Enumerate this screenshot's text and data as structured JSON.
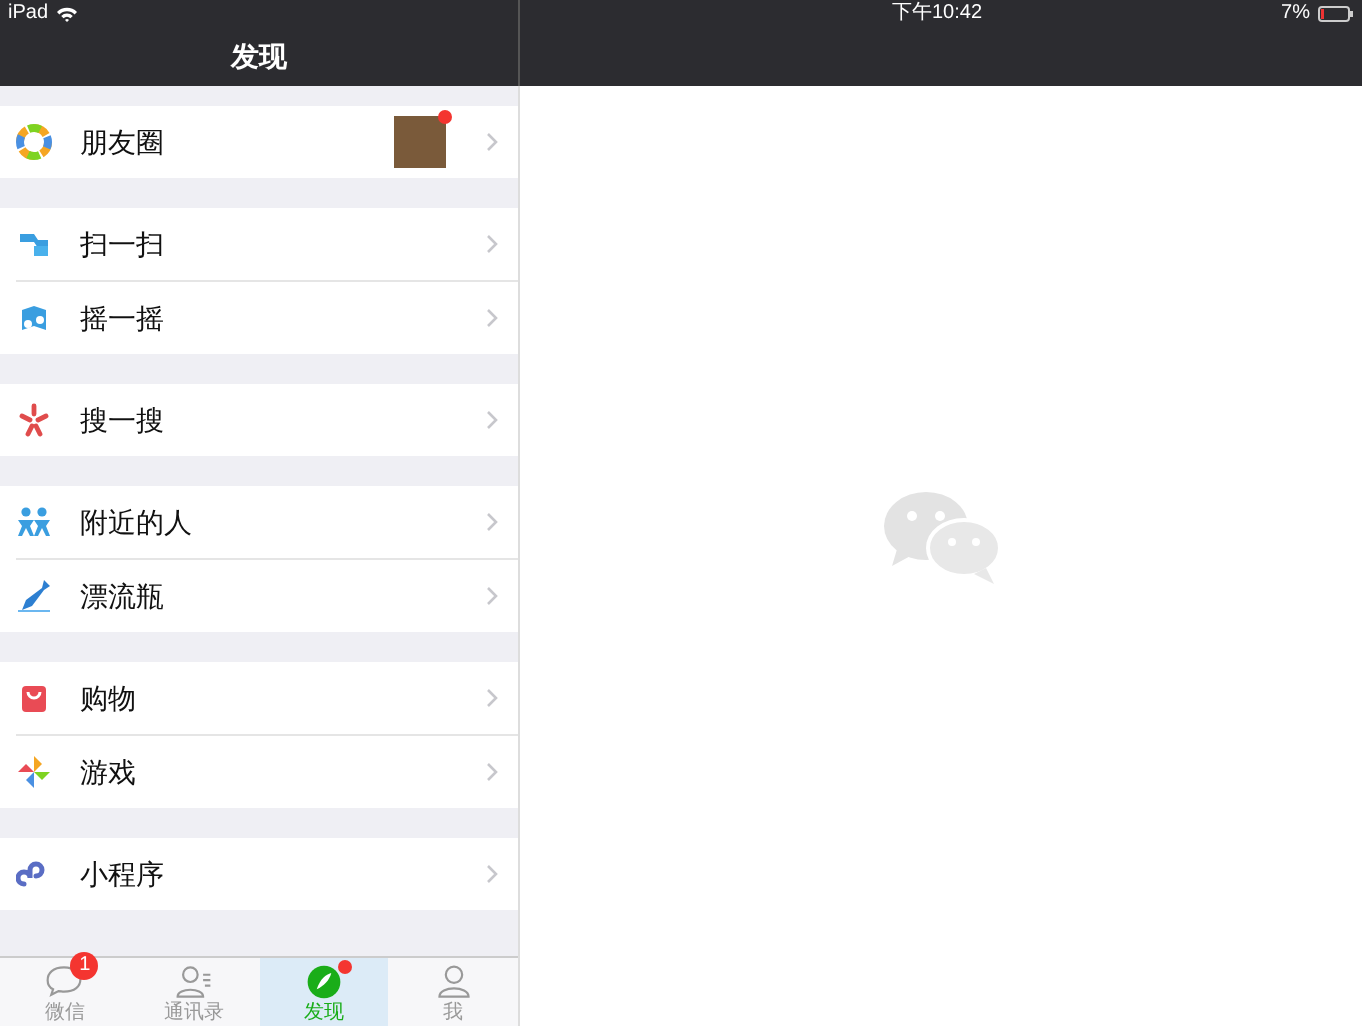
{
  "status_bar": {
    "device": "iPad",
    "time": "下午10:42",
    "battery": "7%"
  },
  "nav_bar": {
    "title": "发现"
  },
  "groups": [
    [
      {
        "kind": "moments",
        "label": "朋友圈",
        "thumbnail": true,
        "dot": true
      }
    ],
    [
      {
        "kind": "scan",
        "label": "扫一扫"
      },
      {
        "kind": "shake",
        "label": "摇一摇"
      }
    ],
    [
      {
        "kind": "search",
        "label": "搜一搜"
      }
    ],
    [
      {
        "kind": "nearby",
        "label": "附近的人"
      },
      {
        "kind": "bottle",
        "label": "漂流瓶"
      }
    ],
    [
      {
        "kind": "shopping",
        "label": "购物"
      },
      {
        "kind": "games",
        "label": "游戏"
      }
    ],
    [
      {
        "kind": "miniprogram",
        "label": "小程序"
      }
    ]
  ],
  "tabs": [
    {
      "kind": "chats",
      "label": "微信",
      "selected": false,
      "badge": "1"
    },
    {
      "kind": "contacts",
      "label": "通讯录",
      "selected": false
    },
    {
      "kind": "discover",
      "label": "发现",
      "selected": true,
      "dot": true
    },
    {
      "kind": "me",
      "label": "我",
      "selected": false
    }
  ]
}
